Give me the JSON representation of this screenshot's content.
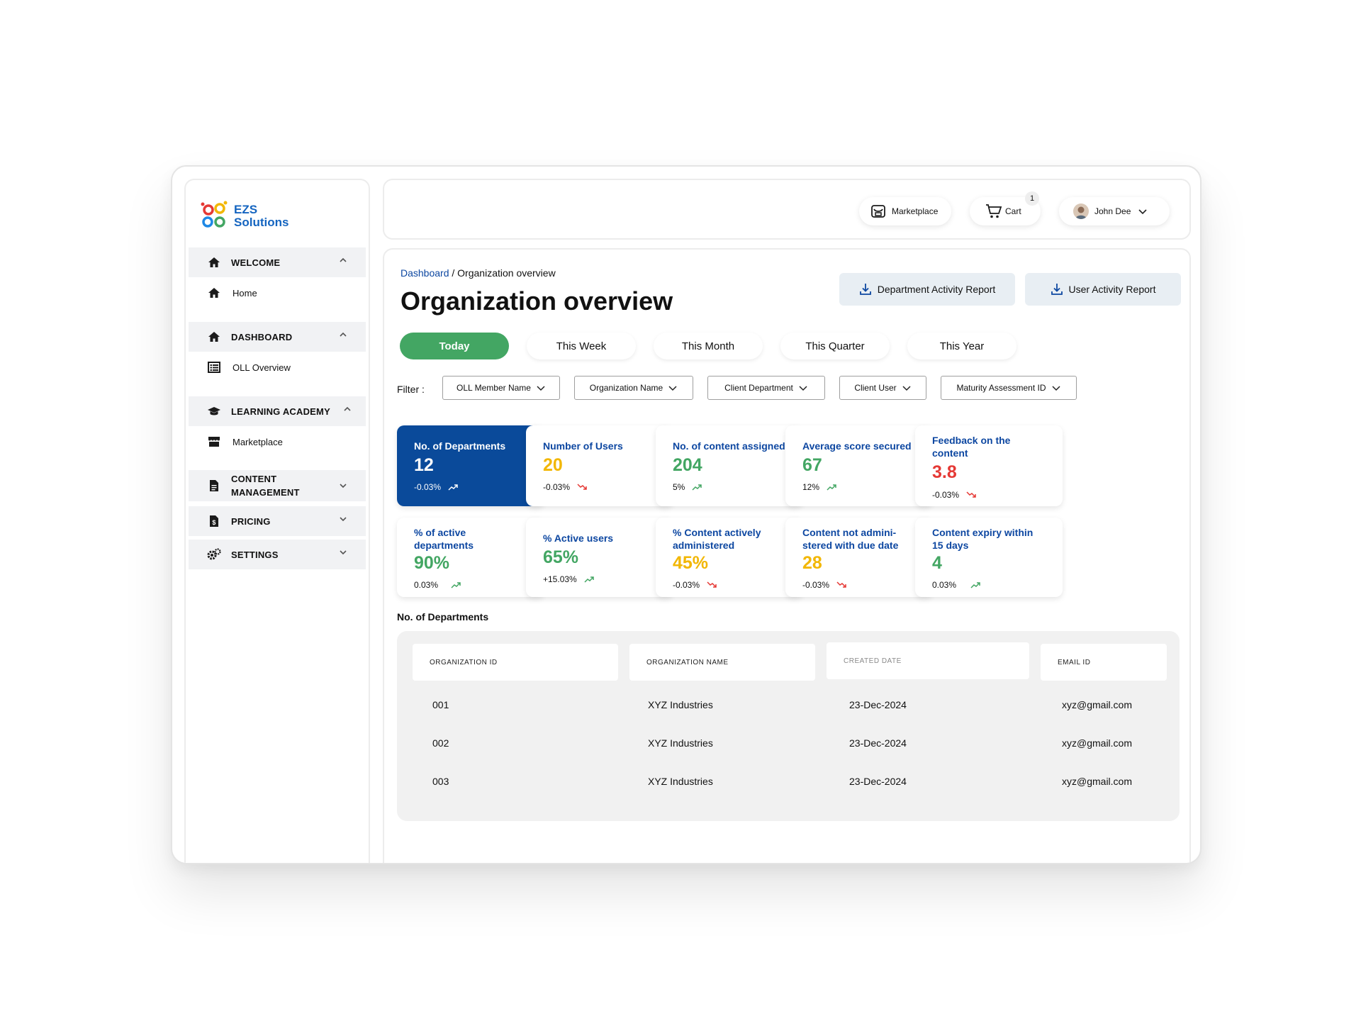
{
  "brand": {
    "name_line1": "EZS",
    "name_line2": "Solutions"
  },
  "sidebar": {
    "sections": [
      {
        "label": "WELCOME",
        "icon": "home-icon",
        "sub": "Home",
        "sub_icon": "home-icon"
      },
      {
        "label": "DASHBOARD",
        "icon": "home-icon",
        "sub": "OLL Overview",
        "sub_icon": "list-icon"
      },
      {
        "label": "LEARNING ACADEMY",
        "icon": "graduation-cap-icon",
        "sub": "Marketplace",
        "sub_icon": "store-icon"
      },
      {
        "label_line1": "CONTENT",
        "label_line2": "MANAGEMENT",
        "icon": "document-icon"
      },
      {
        "label": "PRICING",
        "icon": "price-file-icon"
      },
      {
        "label": "SETTINGS",
        "icon": "gears-icon"
      }
    ]
  },
  "topbar": {
    "marketplace": "Marketplace",
    "cart": "Cart",
    "cart_count": "1",
    "user": "John Dee"
  },
  "breadcrumb": {
    "root": "Dashboard",
    "sep": " / ",
    "current": "Organization overview"
  },
  "page_title": "Organization overview",
  "reports": {
    "department": "Department Activity Report",
    "user": "User Activity Report"
  },
  "tabs": [
    "Today",
    "This Week",
    "This Month",
    "This Quarter",
    "This Year"
  ],
  "active_tab": "Today",
  "filter": {
    "label": "Filter :",
    "options": [
      "OLL Member Name",
      "Organization Name",
      "Client Department",
      "Client User",
      "Maturity Assessment ID"
    ]
  },
  "colors": {
    "green": "#43a663",
    "navy": "#0a4a9a",
    "blue_label": "#0d47a1",
    "yellow": "#f2b705",
    "red": "#e53935"
  },
  "stats": [
    {
      "label": "No. of Departments",
      "value": "12",
      "change": "-0.03%",
      "trend": "up"
    },
    {
      "label": "Number of Users",
      "value": "20",
      "change": "-0.03%",
      "trend": "down",
      "color": "#f2b705"
    },
    {
      "label": "No. of content assigned",
      "value": "204",
      "change": "5%",
      "trend": "up",
      "color": "#43a663"
    },
    {
      "label": "Average score secured",
      "value": "67",
      "change": "12%",
      "trend": "up",
      "color": "#43a663"
    },
    {
      "label_line1": "Feedback on the",
      "label_line2": "content",
      "value": "3.8",
      "change": "-0.03%",
      "trend": "down",
      "color": "#e53935"
    },
    {
      "label_line1": "% of active",
      "label_line2": "departments",
      "value": "90%",
      "change": "0.03%",
      "trend": "up",
      "color": "#43a663"
    },
    {
      "label": "% Active users",
      "value": "65%",
      "change": "+15.03%",
      "trend": "up",
      "color": "#43a663"
    },
    {
      "label_line1": "% Content actively",
      "label_line2": "administered",
      "value": "45%",
      "change": "-0.03%",
      "trend": "down",
      "color": "#f2b705"
    },
    {
      "label_line1": "Content not admini-",
      "label_line2": "stered with due date",
      "value": "28",
      "change": "-0.03%",
      "trend": "down",
      "color": "#f2b705"
    },
    {
      "label_line1": "Content expiry within",
      "label_line2": "15 days",
      "value": "4",
      "change": "0.03%",
      "trend": "up",
      "color": "#43a663"
    }
  ],
  "table": {
    "title": "No. of Departments",
    "columns": [
      "ORGANIZATION ID",
      "ORGANIZATION NAME",
      "CREATED DATE",
      "EMAIL ID"
    ],
    "rows": [
      [
        "001",
        "XYZ Industries",
        "23-Dec-2024",
        "xyz@gmail.com"
      ],
      [
        "002",
        "XYZ Industries",
        "23-Dec-2024",
        "xyz@gmail.com"
      ],
      [
        "003",
        "XYZ Industries",
        "23-Dec-2024",
        "xyz@gmail.com"
      ]
    ]
  }
}
